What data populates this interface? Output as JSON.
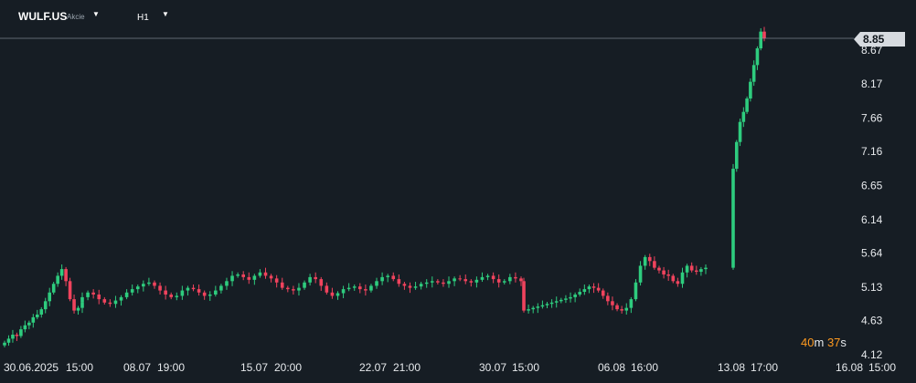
{
  "header": {
    "symbol": "WULF.US",
    "instrument_type": "Akcie",
    "timeframe": "H1"
  },
  "current_price_label": "8.85",
  "countdown": {
    "minutes": "40",
    "minutes_unit": "m",
    "seconds": "37",
    "seconds_unit": "s"
  },
  "colors": {
    "background": "#161d24",
    "up": "#2ecc7e",
    "down": "#f0435d",
    "text": "#e6e9ec"
  },
  "icons": [
    "chevron-down-icon"
  ],
  "chart_data": {
    "type": "candlestick",
    "y_ticks": [
      "8.67",
      "8.17",
      "7.66",
      "7.16",
      "6.65",
      "6.14",
      "5.64",
      "5.13",
      "4.63",
      "4.12"
    ],
    "y_range": [
      4.12,
      8.85
    ],
    "x_ticks": [
      "30.06.2025",
      "15:00",
      "08.07",
      "19:00",
      "15.07",
      "20:00",
      "22.07",
      "21:00",
      "30.07",
      "15:00",
      "06.08",
      "16:00",
      "13.08",
      "17:00",
      "16.08",
      "15:00"
    ],
    "last_price": 8.85,
    "grid": false,
    "close_series": [
      4.3,
      4.36,
      4.42,
      4.4,
      4.5,
      4.56,
      4.6,
      4.68,
      4.72,
      4.8,
      4.92,
      5.05,
      5.18,
      5.3,
      5.4,
      5.22,
      4.95,
      4.78,
      4.82,
      4.9,
      4.98,
      5.05,
      5.02,
      4.95,
      4.9,
      4.88,
      4.93,
      4.98,
      5.05,
      5.1,
      5.14,
      5.18,
      5.2,
      5.15,
      5.08,
      5.02,
      4.98,
      5.0,
      5.08,
      5.12,
      5.1,
      5.05,
      5.0,
      5.02,
      5.08,
      5.15,
      5.22,
      5.3,
      5.32,
      5.28,
      5.24,
      5.3,
      5.35,
      5.3,
      5.26,
      5.2,
      5.12,
      5.1,
      5.08,
      5.12,
      5.2,
      5.28,
      5.25,
      5.15,
      5.05,
      5.0,
      5.04,
      5.1,
      5.12,
      5.14,
      5.1,
      5.08,
      5.15,
      5.22,
      5.28,
      5.3,
      5.25,
      5.18,
      5.15,
      5.12,
      5.14,
      5.18,
      5.2,
      5.22,
      5.2,
      5.18,
      5.22,
      5.26,
      5.25,
      5.22,
      5.2,
      5.24,
      5.28,
      5.3,
      5.25,
      5.2,
      5.22,
      5.28,
      5.26,
      5.22,
      4.78,
      4.8,
      4.82,
      4.84,
      4.86,
      4.88,
      4.9,
      4.92,
      4.94,
      4.96,
      4.98,
      5.02,
      5.06,
      5.1,
      5.14,
      5.12,
      5.08,
      5.0,
      4.92,
      4.86,
      4.8,
      4.78,
      4.82,
      4.95,
      5.2,
      5.45,
      5.58,
      5.52,
      5.42,
      5.38,
      5.32,
      5.3,
      5.22,
      5.18,
      5.35,
      5.45,
      5.38,
      5.36,
      5.4,
      5.42,
      6.9,
      7.3,
      7.6,
      7.75,
      7.95,
      8.2,
      8.45,
      8.7,
      8.95,
      8.85
    ]
  }
}
